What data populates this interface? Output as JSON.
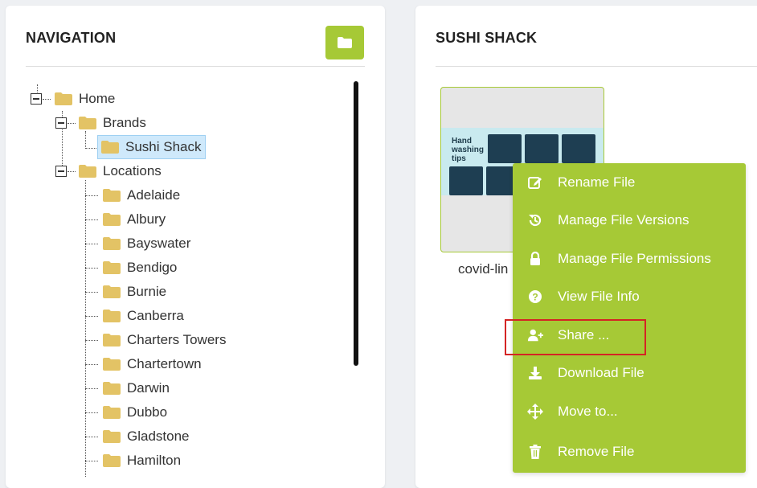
{
  "navigation": {
    "title": "NAVIGATION",
    "new_folder_icon": "folder-icon",
    "tree": {
      "home": "Home",
      "brands": "Brands",
      "sushi_shack": "Sushi Shack",
      "locations": "Locations",
      "location_items": [
        "Adelaide",
        "Albury",
        "Bayswater",
        "Bendigo",
        "Burnie",
        "Canberra",
        "Charters Towers",
        "Chartertown",
        "Darwin",
        "Dubbo",
        "Gladstone",
        "Hamilton"
      ]
    }
  },
  "main": {
    "title": "SUSHI SHACK",
    "file": {
      "name": "covid-lin",
      "thumbnail_title": "Hand washing tips"
    }
  },
  "context_menu": {
    "items": [
      {
        "label": "Rename File",
        "icon": "edit-icon"
      },
      {
        "label": "Manage File Versions",
        "icon": "history-icon"
      },
      {
        "label": "Manage File Permissions",
        "icon": "lock-icon"
      },
      {
        "label": "View File Info",
        "icon": "question-circle-icon"
      },
      {
        "label": "Share ...",
        "icon": "user-plus-icon"
      },
      {
        "label": "Download File",
        "icon": "download-icon"
      },
      {
        "label": "Move to...",
        "icon": "move-arrows-icon"
      },
      {
        "label": "Remove File",
        "icon": "trash-icon"
      }
    ],
    "highlighted_item": "Share ..."
  },
  "colors": {
    "accent": "#a6c936",
    "folder": "#e3c365",
    "selection": "#cfe9fb",
    "highlight_border": "#d42424"
  }
}
